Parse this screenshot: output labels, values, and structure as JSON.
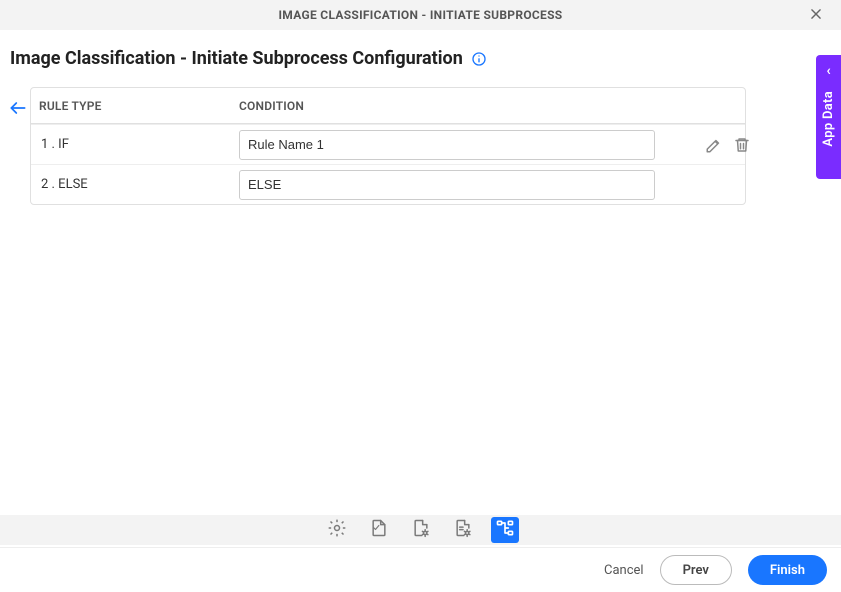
{
  "titlebar": {
    "title": "IMAGE CLASSIFICATION - INITIATE SUBPROCESS"
  },
  "subtitle": "Image Classification - Initiate Subprocess Configuration",
  "sidetab": {
    "label": "App Data"
  },
  "table": {
    "headers": {
      "rule_type": "RULE TYPE",
      "condition": "CONDITION"
    },
    "rows": [
      {
        "rule_label": "1 . IF",
        "condition_value": "Rule Name 1",
        "has_actions": true
      },
      {
        "rule_label": "2 . ELSE",
        "condition_value": "ELSE",
        "has_actions": false
      }
    ]
  },
  "footer": {
    "cancel": "Cancel",
    "prev": "Prev",
    "finish": "Finish"
  },
  "colors": {
    "accent_blue": "#1976ff",
    "accent_purple": "#7a2cff"
  }
}
